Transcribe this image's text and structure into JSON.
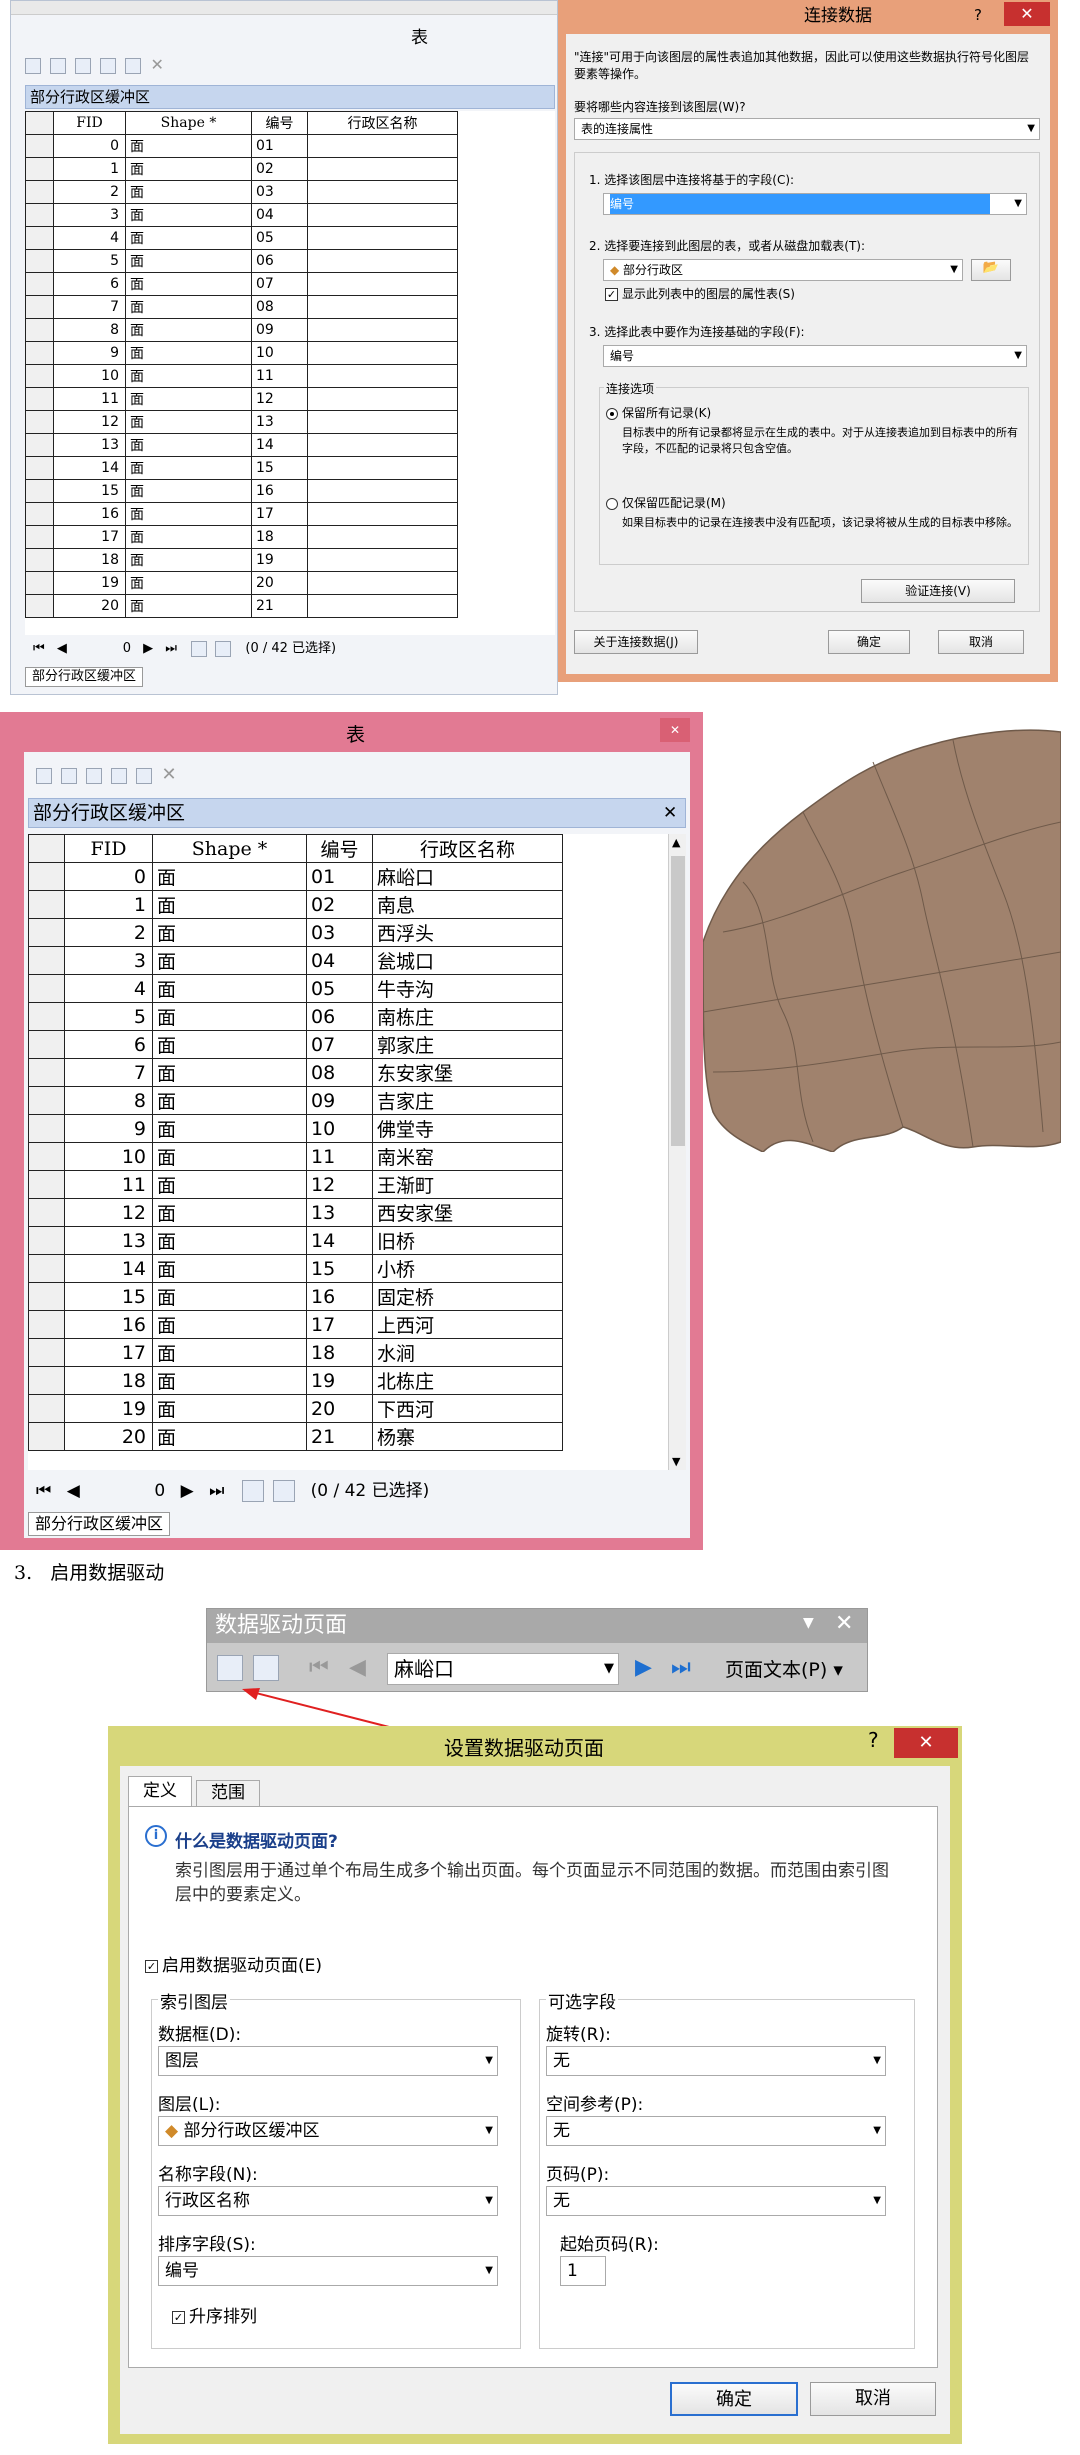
{
  "table1": {
    "window_title": "表",
    "title": "部分行政区缓冲区",
    "headers": [
      "FID",
      "Shape *",
      "编号",
      "行政区名称"
    ],
    "rows": [
      [
        "0",
        "面",
        "01"
      ],
      [
        "1",
        "面",
        "02"
      ],
      [
        "2",
        "面",
        "03"
      ],
      [
        "3",
        "面",
        "04"
      ],
      [
        "4",
        "面",
        "05"
      ],
      [
        "5",
        "面",
        "06"
      ],
      [
        "6",
        "面",
        "07"
      ],
      [
        "7",
        "面",
        "08"
      ],
      [
        "8",
        "面",
        "09"
      ],
      [
        "9",
        "面",
        "10"
      ],
      [
        "10",
        "面",
        "11"
      ],
      [
        "11",
        "面",
        "12"
      ],
      [
        "12",
        "面",
        "13"
      ],
      [
        "13",
        "面",
        "14"
      ],
      [
        "14",
        "面",
        "15"
      ],
      [
        "15",
        "面",
        "16"
      ],
      [
        "16",
        "面",
        "17"
      ],
      [
        "17",
        "面",
        "18"
      ],
      [
        "18",
        "面",
        "19"
      ],
      [
        "19",
        "面",
        "20"
      ],
      [
        "20",
        "面",
        "21"
      ]
    ],
    "nav_record": "0",
    "status": "(0 / 42 已选择)",
    "tab": "部分行政区缓冲区"
  },
  "join_dialog": {
    "title": "连接数据",
    "description": "\"连接\"可用于向该图层的属性表追加其他数据，因此可以使用这些数据执行符号化图层要素等操作。",
    "what_label": "要将哪些内容连接到该图层(W)?",
    "what_value": "表的连接属性",
    "step1": "1. 选择该图层中连接将基于的字段(C):",
    "step1_value": "编号",
    "step2": "2. 选择要连接到此图层的表，或者从磁盘加载表(T):",
    "step2_value": "部分行政区",
    "show_attr": "显示此列表中的图层的属性表(S)",
    "step3": "3. 选择此表中要作为连接基础的字段(F):",
    "step3_value": "编号",
    "options_title": "连接选项",
    "keep_all": "保留所有记录(K)",
    "keep_all_desc": "目标表中的所有记录都将显示在生成的表中。对于从连接表追加到目标表中的所有字段，不匹配的记录将只包含空值。",
    "keep_match": "仅保留匹配记录(M)",
    "keep_match_desc": "如果目标表中的记录在连接表中没有匹配项，该记录将被从生成的目标表中移除。",
    "validate": "验证连接(V)",
    "about": "关于连接数据(J)",
    "ok": "确定",
    "cancel": "取消"
  },
  "table2": {
    "window_title": "表",
    "title": "部分行政区缓冲区",
    "headers": [
      "FID",
      "Shape *",
      "编号",
      "行政区名称"
    ],
    "rows": [
      [
        "0",
        "面",
        "01",
        "麻峪口"
      ],
      [
        "1",
        "面",
        "02",
        "南息"
      ],
      [
        "2",
        "面",
        "03",
        "西浮头"
      ],
      [
        "3",
        "面",
        "04",
        "瓮城口"
      ],
      [
        "4",
        "面",
        "05",
        "牛寺沟"
      ],
      [
        "5",
        "面",
        "06",
        "南栋庄"
      ],
      [
        "6",
        "面",
        "07",
        "郭家庄"
      ],
      [
        "7",
        "面",
        "08",
        "东安家堡"
      ],
      [
        "8",
        "面",
        "09",
        "吉家庄"
      ],
      [
        "9",
        "面",
        "10",
        "佛堂寺"
      ],
      [
        "10",
        "面",
        "11",
        "南米窑"
      ],
      [
        "11",
        "面",
        "12",
        "王渐町"
      ],
      [
        "12",
        "面",
        "13",
        "西安家堡"
      ],
      [
        "13",
        "面",
        "14",
        "旧桥"
      ],
      [
        "14",
        "面",
        "15",
        "小桥"
      ],
      [
        "15",
        "面",
        "16",
        "固定桥"
      ],
      [
        "16",
        "面",
        "17",
        "上西河"
      ],
      [
        "17",
        "面",
        "18",
        "水涧"
      ],
      [
        "18",
        "面",
        "19",
        "北栋庄"
      ],
      [
        "19",
        "面",
        "20",
        "下西河"
      ],
      [
        "20",
        "面",
        "21",
        "杨寨"
      ]
    ],
    "nav_record": "0",
    "status": "(0 / 42 已选择)",
    "tab": "部分行政区缓冲区"
  },
  "step_heading": "3.   启用数据驱动",
  "ddp_toolbar": {
    "title": "数据驱动页面",
    "page_value": "麻峪口",
    "page_text": "页面文本(P)"
  },
  "ddp_dialog": {
    "title": "设置数据驱动页面",
    "tabs": [
      "定义",
      "范围"
    ],
    "info_title": "什么是数据驱动页面?",
    "info_text": "索引图层用于通过单个布局生成多个输出页面。每个页面显示不同范围的数据。而范围由索引图层中的要素定义。",
    "enable": "启用数据驱动页面(E)",
    "index_group": "索引图层",
    "frame_label": "数据框(D):",
    "frame_value": "图层",
    "layer_label": "图层(L):",
    "layer_value": "部分行政区缓冲区",
    "name_label": "名称字段(N):",
    "name_value": "行政区名称",
    "sort_label": "排序字段(S):",
    "sort_value": "编号",
    "ascending": "升序排列",
    "optional_group": "可选字段",
    "rotation_label": "旋转(R):",
    "rotation_value": "无",
    "spatial_label": "空间参考(P):",
    "spatial_value": "无",
    "page_label": "页码(P):",
    "page_value": "无",
    "start_label": "起始页码(R):",
    "start_value": "1",
    "ok": "确定",
    "cancel": "取消"
  },
  "colors": {
    "map_fill": "#a0826d",
    "dialog_border": "#e8a07a",
    "table2_border": "#e27a93",
    "title_blue": "#c6d6ee",
    "ddp_border": "#d7d77a"
  }
}
